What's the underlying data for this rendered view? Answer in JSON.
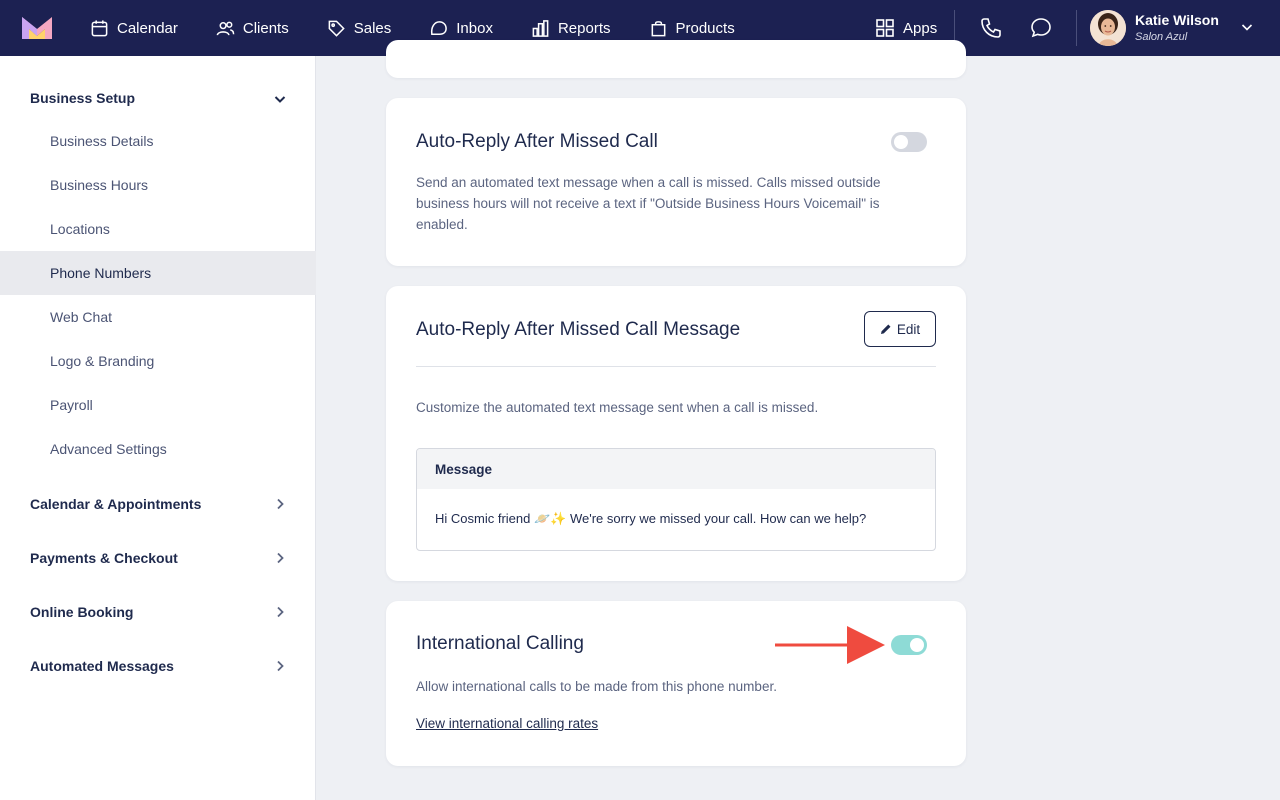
{
  "topbar": {
    "nav": [
      {
        "label": "Calendar",
        "icon": "calendar-icon"
      },
      {
        "label": "Clients",
        "icon": "users-icon"
      },
      {
        "label": "Sales",
        "icon": "tag-icon"
      },
      {
        "label": "Inbox",
        "icon": "inbox-icon"
      },
      {
        "label": "Reports",
        "icon": "bar-chart-icon"
      },
      {
        "label": "Products",
        "icon": "shopping-bag-icon"
      }
    ],
    "apps_label": "Apps",
    "user": {
      "name": "Katie Wilson",
      "org": "Salon Azul"
    }
  },
  "sidebar": {
    "sections": [
      {
        "label": "Business Setup",
        "expanded": true
      },
      {
        "label": "Calendar & Appointments",
        "expanded": false
      },
      {
        "label": "Payments & Checkout",
        "expanded": false
      },
      {
        "label": "Online Booking",
        "expanded": false
      },
      {
        "label": "Automated Messages",
        "expanded": false
      }
    ],
    "items": [
      {
        "label": "Business Details",
        "active": false
      },
      {
        "label": "Business Hours",
        "active": false
      },
      {
        "label": "Locations",
        "active": false
      },
      {
        "label": "Phone Numbers",
        "active": true
      },
      {
        "label": "Web Chat",
        "active": false
      },
      {
        "label": "Logo & Branding",
        "active": false
      },
      {
        "label": "Payroll",
        "active": false
      },
      {
        "label": "Advanced Settings",
        "active": false
      }
    ]
  },
  "cards": {
    "auto_reply": {
      "title": "Auto-Reply After Missed Call",
      "description": "Send an automated text message when a call is missed. Calls missed outside business hours will not receive a text if \"Outside Business Hours Voicemail\" is enabled.",
      "enabled": false
    },
    "auto_reply_message": {
      "title": "Auto-Reply After Missed Call Message",
      "edit_label": "Edit",
      "description": "Customize the automated text message sent when a call is missed.",
      "message_header": "Message",
      "message_text": "Hi Cosmic friend 🪐✨ We're sorry we missed your call. How can we help?"
    },
    "international": {
      "title": "International Calling",
      "description": "Allow international calls to be made from this phone number.",
      "link": "View international calling rates",
      "enabled": true
    }
  },
  "colors": {
    "topbar": "#1c2152",
    "toggle_on": "#8edbd6",
    "toggle_off": "#d4d7df",
    "arrow": "#ef4b3f"
  }
}
